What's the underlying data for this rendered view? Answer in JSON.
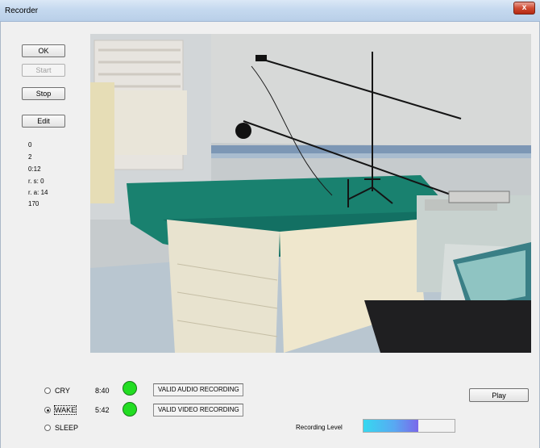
{
  "window": {
    "title": "Recorder",
    "close_glyph": "x"
  },
  "buttons": {
    "ok": "OK",
    "start": "Start",
    "stop": "Stop",
    "edit": "Edit",
    "play": "Play"
  },
  "stats": [
    "0",
    "2",
    "0:12",
    "r. s: 0",
    "r. a: 14",
    "170"
  ],
  "states": [
    {
      "label": "CRY",
      "selected": false,
      "time": "8:40",
      "status": "VALID AUDIO RECORDING"
    },
    {
      "label": "WAKE",
      "selected": true,
      "time": "5:42",
      "status": "VALID VIDEO RECORDING"
    },
    {
      "label": "SLEEP",
      "selected": false
    }
  ],
  "recording_level": {
    "label": "Recording Level",
    "fraction": 0.6
  },
  "colors": {
    "indicator": "#22dd22",
    "title_bar": "#c5d9ef"
  }
}
